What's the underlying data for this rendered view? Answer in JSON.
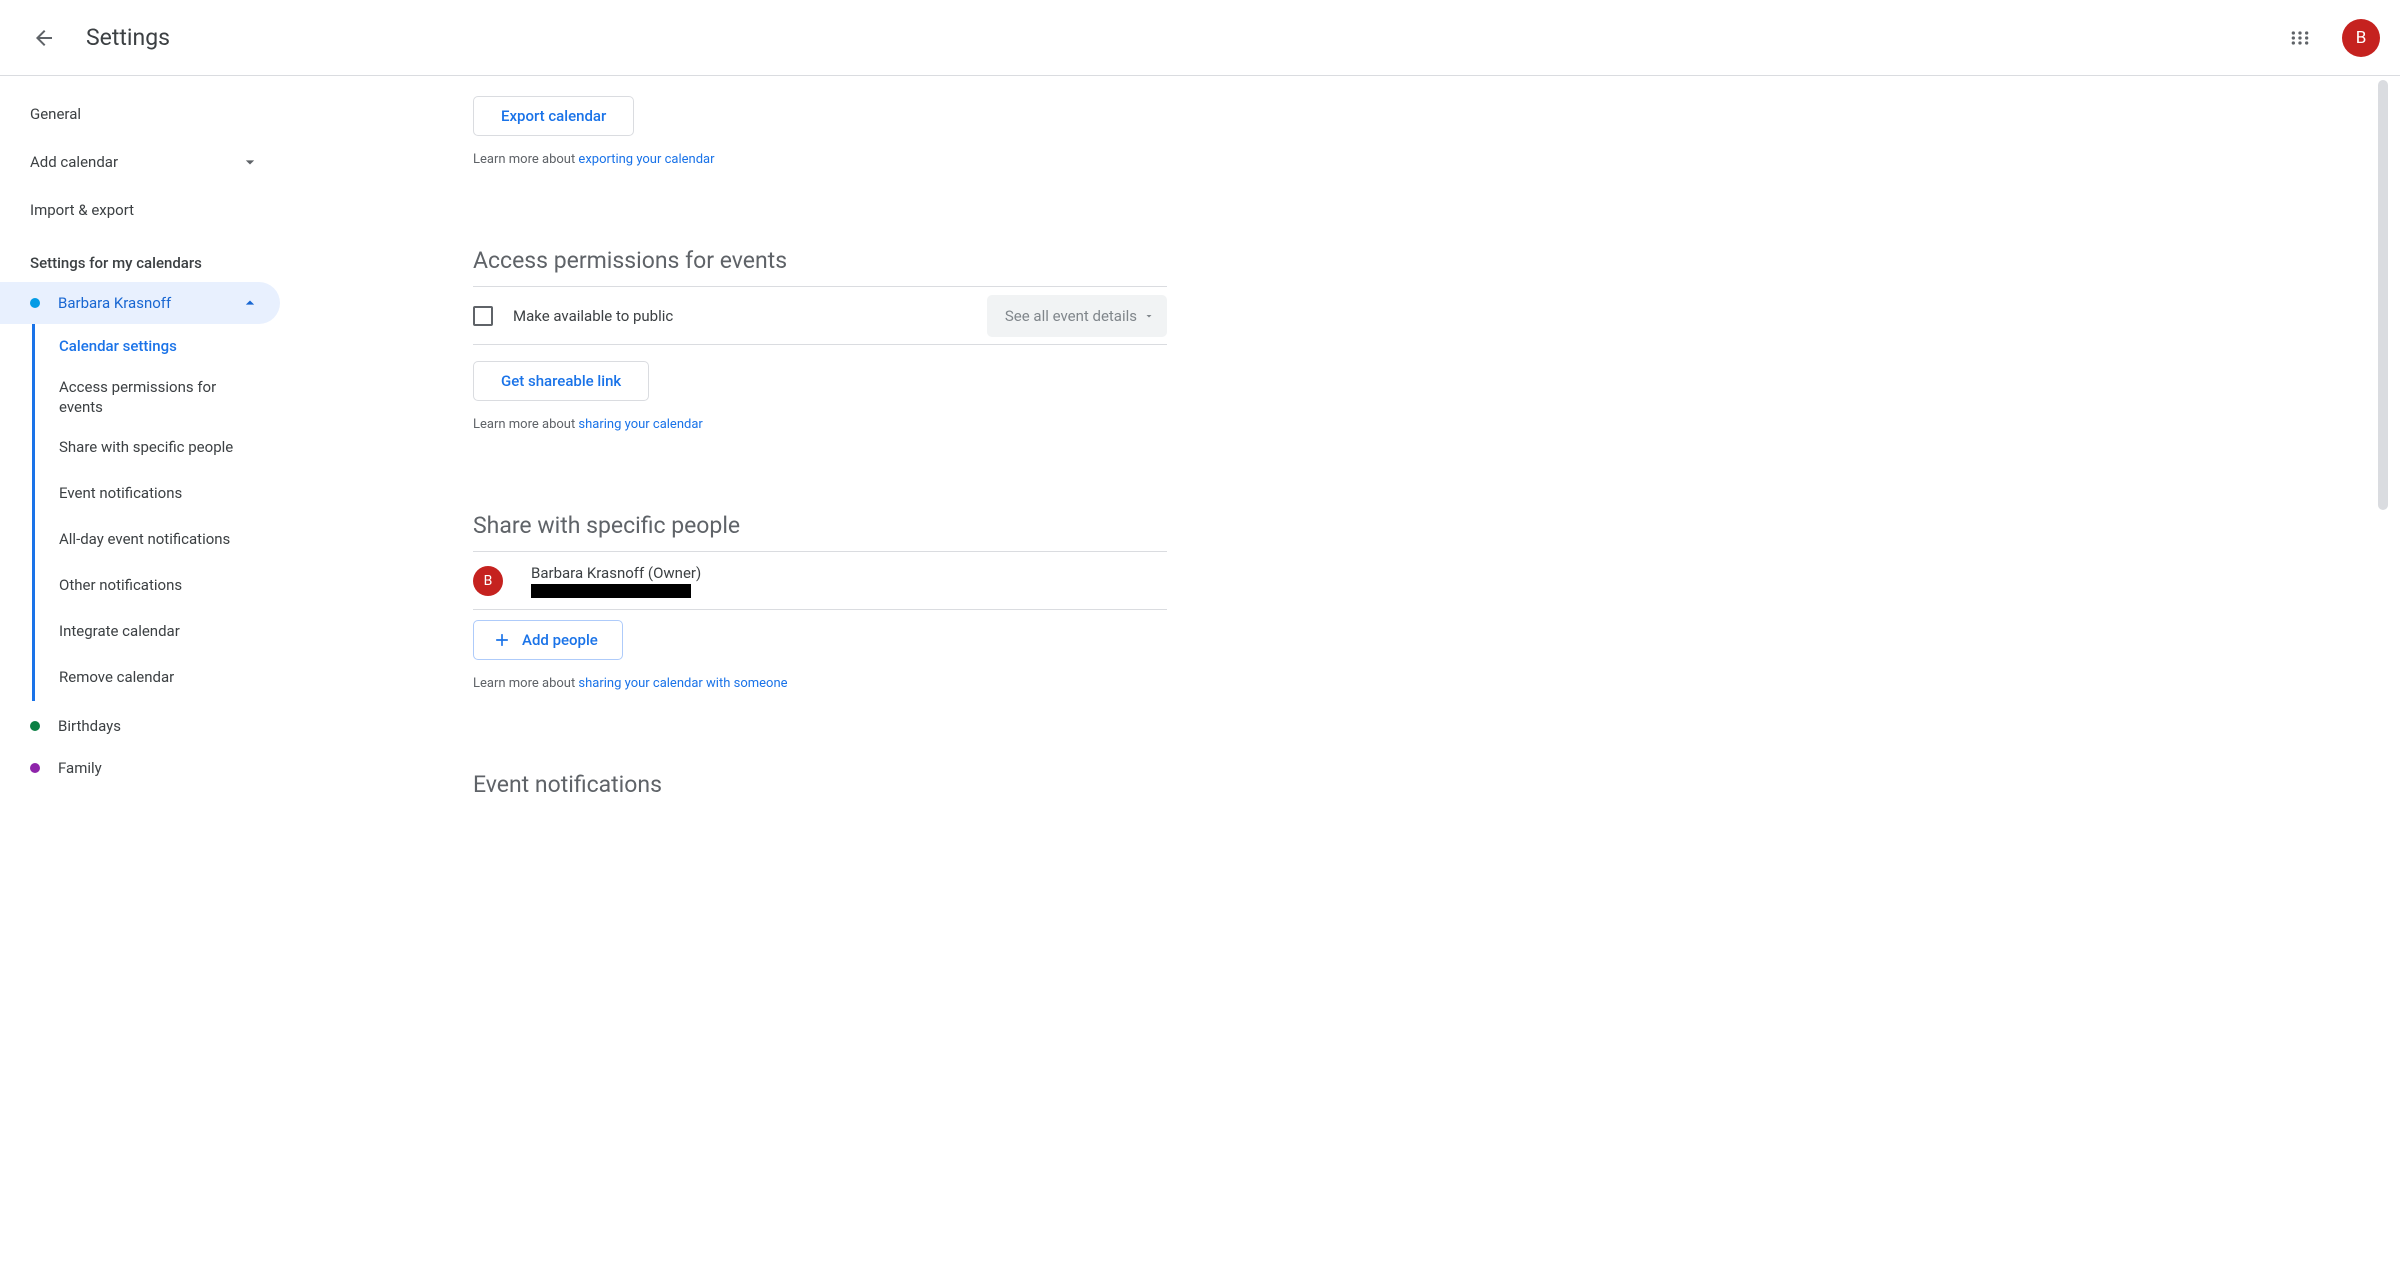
{
  "header": {
    "title": "Settings",
    "avatar_initial": "B"
  },
  "sidebar": {
    "top_items": {
      "general": "General",
      "add_calendar": "Add calendar",
      "import_export": "Import & export"
    },
    "heading": "Settings for my calendars",
    "calendar": {
      "name": "Barbara Krasnoff",
      "color": "#039be5"
    },
    "sub_items": {
      "calendar_settings": "Calendar settings",
      "access_permissions": "Access permissions for events",
      "share_specific": "Share with specific people",
      "event_notifications": "Event notifications",
      "all_day": "All-day event notifications",
      "other_notifications": "Other notifications",
      "integrate": "Integrate calendar",
      "remove": "Remove calendar"
    },
    "other_calendars": {
      "birthdays": {
        "label": "Birthdays",
        "color": "#0b8043"
      },
      "family": {
        "label": "Family",
        "color": "#8e24aa"
      }
    }
  },
  "main": {
    "export": {
      "button": "Export calendar",
      "learn_prefix": "Learn more about ",
      "learn_link": "exporting your calendar"
    },
    "access": {
      "title": "Access permissions for events",
      "checkbox_label": "Make available to public",
      "dropdown": "See all event details",
      "get_link_button": "Get shareable link",
      "learn_prefix": "Learn more about ",
      "learn_link": "sharing your calendar"
    },
    "share": {
      "title": "Share with specific people",
      "owner_name": "Barbara Krasnoff (Owner)",
      "owner_initial": "B",
      "add_button": "Add people",
      "learn_prefix": "Learn more about ",
      "learn_link": "sharing your calendar with someone"
    },
    "notifications": {
      "title": "Event notifications"
    }
  }
}
